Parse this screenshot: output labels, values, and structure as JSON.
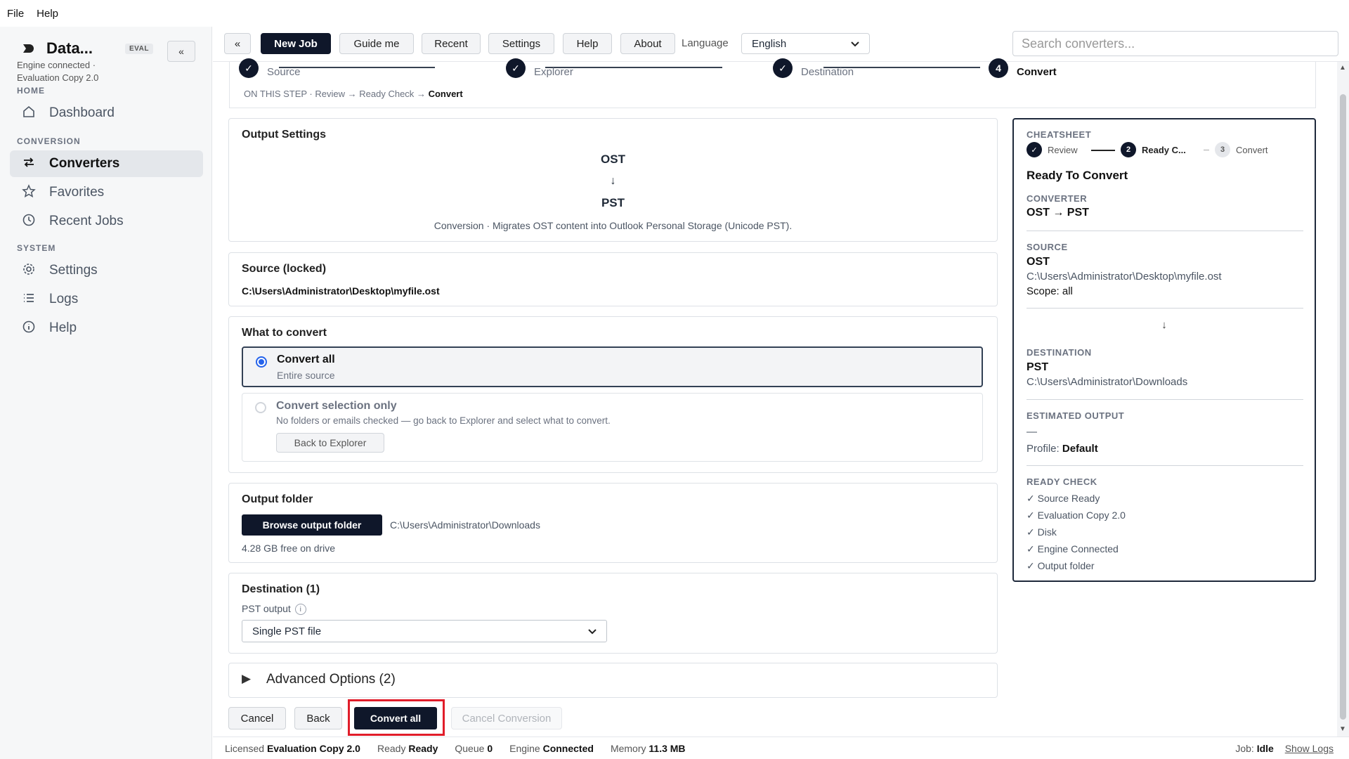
{
  "menu": {
    "file": "File",
    "help": "Help"
  },
  "brand": {
    "title": "Data...",
    "badge": "EVAL",
    "collapse": "«",
    "status_line1": "Engine connected ·",
    "status_line2": "Evaluation Copy 2.0"
  },
  "nav": {
    "home": "HOME",
    "dashboard": "Dashboard",
    "conversion": "CONVERSION",
    "converters": "Converters",
    "favorites": "Favorites",
    "recent_jobs": "Recent Jobs",
    "system": "SYSTEM",
    "settings": "Settings",
    "logs": "Logs",
    "help": "Help"
  },
  "toolbar": {
    "collapse": "«",
    "new_job": "New Job",
    "guide_me": "Guide me",
    "recent": "Recent",
    "settings": "Settings",
    "help": "Help",
    "about": "About",
    "language_label": "Language",
    "language_value": "English",
    "search_placeholder": "Search converters..."
  },
  "stepper": {
    "steps": [
      {
        "label": "Source",
        "mark": "✓"
      },
      {
        "label": "Explorer",
        "mark": "✓"
      },
      {
        "label": "Destination",
        "mark": "✓"
      },
      {
        "label": "Convert",
        "mark": "4"
      }
    ],
    "on_step_prefix": "ON THIS STEP ·",
    "on_step_a": "Review",
    "on_step_b": "Ready Check",
    "on_step_c": "Convert",
    "arrow": "→"
  },
  "output_settings": {
    "title": "Output Settings",
    "from": "OST",
    "arrow": "↓",
    "to": "PST",
    "description": "Conversion · Migrates OST content into Outlook Personal Storage (Unicode PST)."
  },
  "source": {
    "title": "Source (locked)",
    "path": "C:\\Users\\Administrator\\Desktop\\myfile.ost"
  },
  "what_to_convert": {
    "title": "What to convert",
    "all_label": "Convert all",
    "all_sub": "Entire source",
    "selection_label": "Convert selection only",
    "selection_sub": "No folders or emails checked — go back to Explorer and select what to convert.",
    "back_to_explorer": "Back to Explorer"
  },
  "output_folder": {
    "title": "Output folder",
    "browse": "Browse output folder",
    "path": "C:\\Users\\Administrator\\Downloads",
    "free": "4.28 GB free on drive"
  },
  "destination": {
    "title": "Destination (1)",
    "pst_output_label": "PST output",
    "info": "i",
    "value": "Single PST file"
  },
  "advanced": {
    "label": "Advanced Options (2)",
    "toggle": "▶"
  },
  "footer": {
    "cancel": "Cancel",
    "back": "Back",
    "convert_all": "Convert all",
    "cancel_conversion": "Cancel Conversion"
  },
  "cheatsheet": {
    "title": "CHEATSHEET",
    "mini_steps": [
      {
        "mark": "✓",
        "label": "Review"
      },
      {
        "mark": "2",
        "label": "Ready C..."
      },
      {
        "mark": "3",
        "label": "Convert"
      }
    ],
    "heading": "Ready To Convert",
    "converter_label": "CONVERTER",
    "converter_value": "OST → PST",
    "source_label": "SOURCE",
    "source_format": "OST",
    "source_path": "C:\\Users\\Administrator\\Desktop\\myfile.ost",
    "source_scope": "Scope: all",
    "arrow": "↓",
    "destination_label": "DESTINATION",
    "destination_format": "PST",
    "destination_path": "C:\\Users\\Administrator\\Downloads",
    "estimated_label": "ESTIMATED OUTPUT",
    "estimated_value": "—",
    "profile_label": "Profile:",
    "profile_value": "Default",
    "ready_check_label": "READY CHECK",
    "checks": [
      "✓ Source Ready",
      "✓ Evaluation Copy 2.0",
      "✓ Disk",
      "✓ Engine Connected",
      "✓ Output folder"
    ]
  },
  "statusbar": {
    "licensed_label": "Licensed",
    "licensed_value": "Evaluation Copy 2.0",
    "ready_label": "Ready",
    "ready_value": "Ready",
    "queue_label": "Queue",
    "queue_value": "0",
    "engine_label": "Engine",
    "engine_value": "Connected",
    "memory_label": "Memory",
    "memory_value": "11.3 MB",
    "job_label": "Job:",
    "job_value": "Idle",
    "show_logs": "Show Logs"
  },
  "colors": {
    "primary_dark": "#0f172a",
    "highlight_red": "#e11d2a",
    "radio_blue": "#2563eb"
  }
}
